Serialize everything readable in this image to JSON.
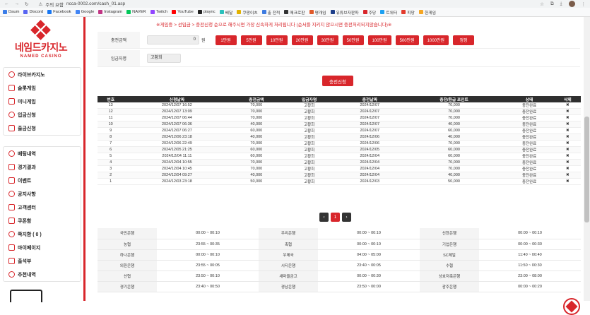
{
  "browser": {
    "security": "주의 요함",
    "url": "ncca-0002.com/cash_01.asp",
    "bookmarks": [
      {
        "label": "Daum",
        "color": "#3b7de8"
      },
      {
        "label": "Discord",
        "color": "#5865f2"
      },
      {
        "label": "Facebook",
        "color": "#1877f2"
      },
      {
        "label": "Google",
        "color": "#4285f4"
      },
      {
        "label": "Instagram",
        "color": "#c13584"
      },
      {
        "label": "NAVER",
        "color": "#03c75a"
      },
      {
        "label": "Twitch",
        "color": "#9146ff"
      },
      {
        "label": "YouTube",
        "color": "#ff0000"
      },
      {
        "label": "plaync",
        "color": "#222222"
      },
      {
        "label": "배달",
        "color": "#2ac1bc"
      },
      {
        "label": "쿠팡이츠",
        "color": "#e2b100"
      },
      {
        "label": "출 전적",
        "color": "#3d7be0"
      },
      {
        "label": "매크로판",
        "color": "#333333"
      },
      {
        "label": "명개임",
        "color": "#e05a2a"
      },
      {
        "label": "유튜브자판파",
        "color": "#1d3f8a"
      },
      {
        "label": "주당",
        "color": "#d8262b"
      },
      {
        "label": "트위터",
        "color": "#1da1f2"
      },
      {
        "label": "피망",
        "color": "#e33b2c"
      },
      {
        "label": "한게임",
        "color": "#f5a623"
      }
    ]
  },
  "logo": {
    "title": "네임드카지노",
    "sub": "NAMED CASINO"
  },
  "sidebar": {
    "group1": [
      "라이브카지노",
      "슬롯게임",
      "미니게임",
      "입금신청",
      "출금신청"
    ],
    "group2": [
      "배팅내역",
      "경기결과",
      "이벤트",
      "공지사항",
      "고객센터",
      "쿠폰함",
      "쪽지함 ( 0 )",
      "마이페이지",
      "출석부",
      "추천내역"
    ]
  },
  "form": {
    "notice": "※게임중 > 선입금 > 충전신청 순으로 해주시면 가장 신속하게 처리됩니다 (순서를 지키지 않으시면 충전처리되지않습니다)※",
    "amount_label": "충전금액",
    "amount_value": "0",
    "won": "원",
    "amount_buttons": [
      "1만원",
      "5만원",
      "10만원",
      "20만원",
      "30만원",
      "50만원",
      "100만원",
      "500만원",
      "1000만원",
      "정정"
    ],
    "depositor_label": "입금자명",
    "depositor_value": "고황희",
    "submit": "충전신청"
  },
  "history": {
    "columns": [
      "번호",
      "신청날짜",
      "충전금액",
      "입금자명",
      "충전날짜",
      "충전/환급 포인트",
      "상태",
      "삭제"
    ],
    "rows": [
      [
        "13",
        "2024/12/07 16:52",
        "70,000",
        "고황희",
        "2024/12/07",
        "70,000",
        "충전완료",
        "✖"
      ],
      [
        "12",
        "2024/12/07 13:09",
        "70,000",
        "고황희",
        "2024/12/07",
        "70,000",
        "충전완료",
        "✖"
      ],
      [
        "11",
        "2024/12/07 06:44",
        "70,000",
        "고황희",
        "2024/12/07",
        "70,000",
        "충전완료",
        "✖"
      ],
      [
        "10",
        "2024/12/07 06:36",
        "40,000",
        "고황희",
        "2024/12/07",
        "40,000",
        "충전완료",
        "✖"
      ],
      [
        "9",
        "2024/12/07 06:27",
        "60,000",
        "고황희",
        "2024/12/07",
        "60,000",
        "충전완료",
        "✖"
      ],
      [
        "8",
        "2024/12/06 23:18",
        "40,000",
        "고황희",
        "2024/12/06",
        "40,000",
        "충전완료",
        "✖"
      ],
      [
        "7",
        "2024/12/06 22:49",
        "70,000",
        "고황희",
        "2024/12/06",
        "70,000",
        "충전완료",
        "✖"
      ],
      [
        "6",
        "2024/12/05 21:25",
        "60,000",
        "고황희",
        "2024/12/05",
        "60,000",
        "충전완료",
        "✖"
      ],
      [
        "5",
        "2024/12/04 11:11",
        "60,000",
        "고황희",
        "2024/12/04",
        "60,000",
        "충전완료",
        "✖"
      ],
      [
        "4",
        "2024/12/04 10:55",
        "70,000",
        "고황희",
        "2024/12/04",
        "70,000",
        "충전완료",
        "✖"
      ],
      [
        "3",
        "2024/12/04 10:45",
        "70,000",
        "고황희",
        "2024/12/04",
        "70,000",
        "충전완료",
        "✖"
      ],
      [
        "2",
        "2024/12/04 09:27",
        "40,000",
        "고황희",
        "2024/12/04",
        "40,000",
        "충전완료",
        "✖"
      ],
      [
        "1",
        "2024/12/03 23:18",
        "50,000",
        "고황희",
        "2024/12/03",
        "50,000",
        "충전완료",
        "✖"
      ]
    ]
  },
  "pager": {
    "prev": "‹",
    "current": "1",
    "next": "›"
  },
  "banks": [
    [
      "국민은행",
      "00:00 ~ 00:10",
      "우리은행",
      "00:00 ~ 00:10",
      "신한은행",
      "00:00 ~ 00:10"
    ],
    [
      "농협",
      "23:55 ~ 00:35",
      "축협",
      "00:00 ~ 00:10",
      "기업은행",
      "00:00 ~ 00:30"
    ],
    [
      "하나은행",
      "00:00 ~ 00:10",
      "우체국",
      "04:00 ~ 05:00",
      "SC제일",
      "11:40 ~ 00:40"
    ],
    [
      "외환은행",
      "23:55 ~ 00:05",
      "시티은행",
      "23:40 ~ 00:05",
      "수협",
      "11:50 ~ 00:30"
    ],
    [
      "산협",
      "23:50 ~ 00:10",
      "새마을금고",
      "00:00 ~ 00:30",
      "상호저축은행",
      "23:00 ~ 08:00"
    ],
    [
      "경기은행",
      "23:40 ~ 00:50",
      "경남은행",
      "23:50 ~ 00:00",
      "광주은행",
      "00:00 ~ 00:20"
    ]
  ],
  "colors": {
    "accent": "#d8262b",
    "table_header": "#2f2f2f"
  }
}
